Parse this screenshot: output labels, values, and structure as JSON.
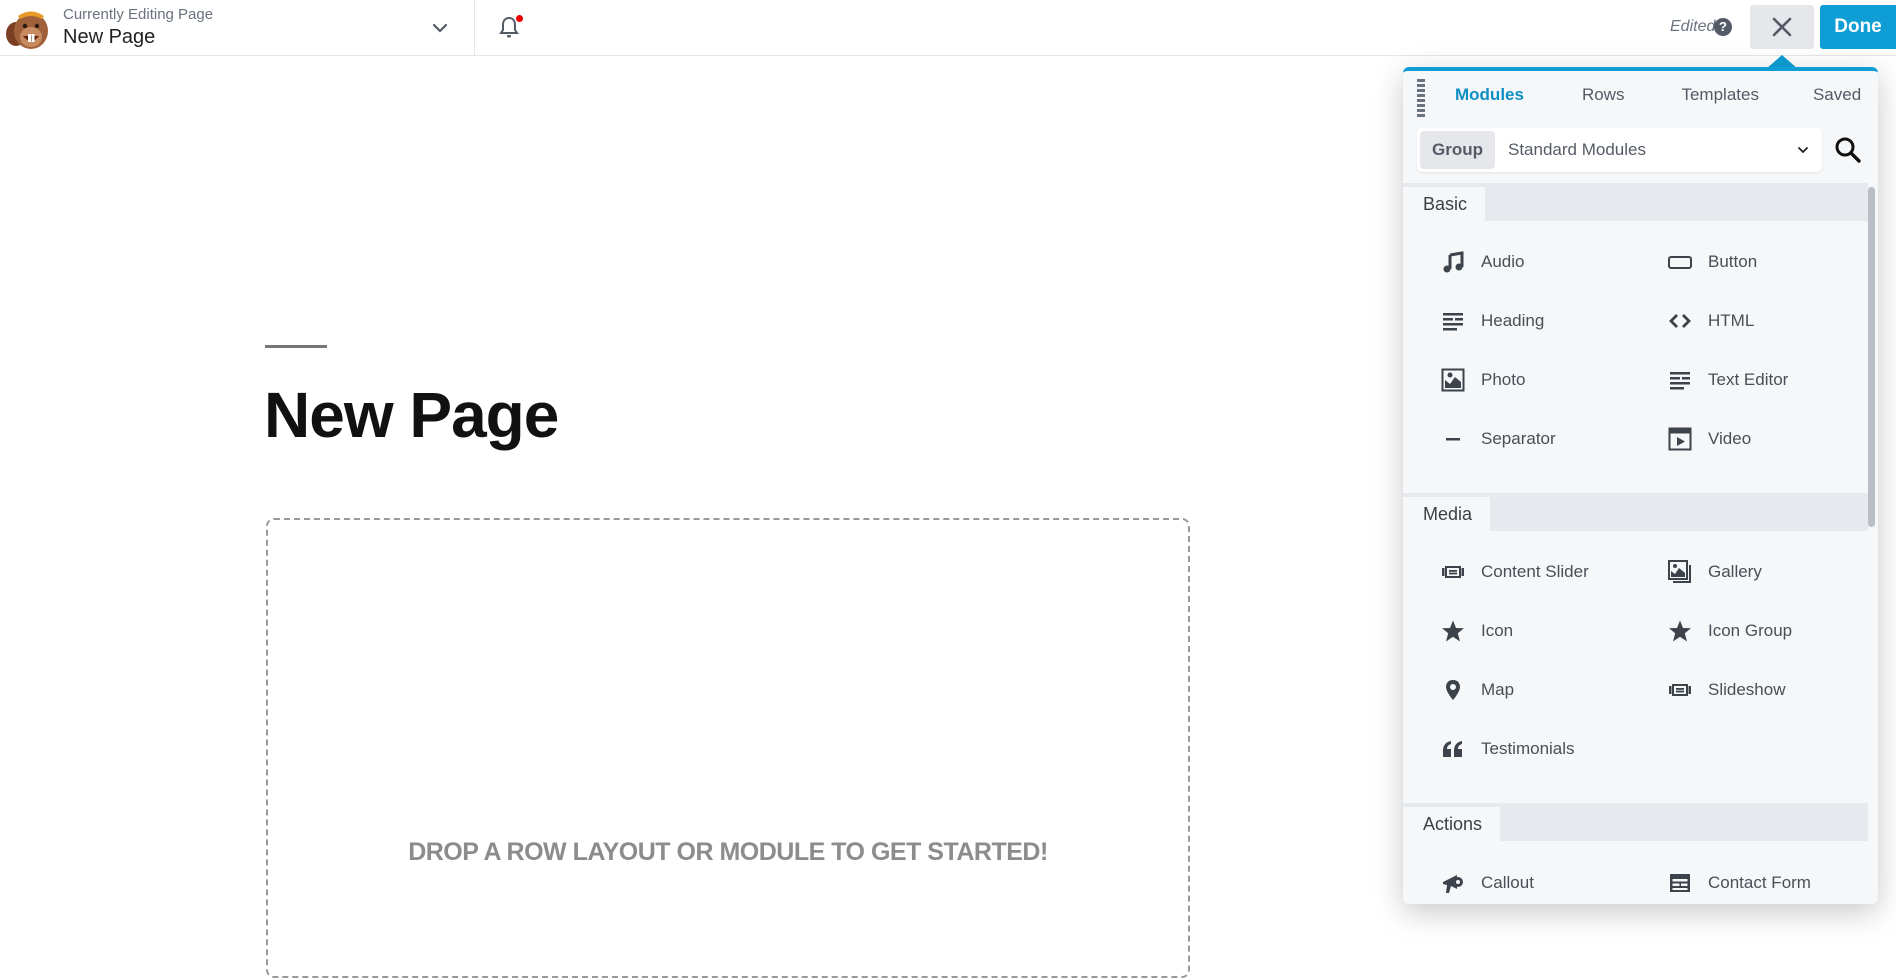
{
  "topbar": {
    "subtitle": "Currently Editing Page",
    "title": "New Page",
    "status": "Edited",
    "help_glyph": "?",
    "close_glyph": "×",
    "done_label": "Done",
    "notification_badge_color": "#e00000"
  },
  "page": {
    "heading": "New Page",
    "drop_prompt": "DROP A ROW LAYOUT OR MODULE TO GET STARTED!"
  },
  "panel": {
    "accent_color": "#0e9ed5",
    "tabs": [
      {
        "label": "Modules",
        "active": true
      },
      {
        "label": "Rows",
        "active": false
      },
      {
        "label": "Templates",
        "active": false
      },
      {
        "label": "Saved",
        "active": false
      }
    ],
    "group": {
      "label": "Group",
      "value": "Standard Modules"
    },
    "sections": [
      {
        "title": "Basic",
        "modules": [
          {
            "label": "Audio",
            "icon": "music-note-icon"
          },
          {
            "label": "Button",
            "icon": "button-icon"
          },
          {
            "label": "Heading",
            "icon": "heading-lines-icon"
          },
          {
            "label": "HTML",
            "icon": "code-brackets-icon"
          },
          {
            "label": "Photo",
            "icon": "photo-icon"
          },
          {
            "label": "Text Editor",
            "icon": "text-lines-icon"
          },
          {
            "label": "Separator",
            "icon": "minus-icon"
          },
          {
            "label": "Video",
            "icon": "video-clapper-icon"
          }
        ]
      },
      {
        "title": "Media",
        "modules": [
          {
            "label": "Content Slider",
            "icon": "slider-icon"
          },
          {
            "label": "Gallery",
            "icon": "gallery-icon"
          },
          {
            "label": "Icon",
            "icon": "star-icon"
          },
          {
            "label": "Icon Group",
            "icon": "star-icon"
          },
          {
            "label": "Map",
            "icon": "map-pin-icon"
          },
          {
            "label": "Slideshow",
            "icon": "slider-icon"
          },
          {
            "label": "Testimonials",
            "icon": "quote-icon"
          }
        ]
      },
      {
        "title": "Actions",
        "modules": [
          {
            "label": "Callout",
            "icon": "megaphone-icon"
          },
          {
            "label": "Contact Form",
            "icon": "form-icon"
          }
        ]
      }
    ]
  }
}
